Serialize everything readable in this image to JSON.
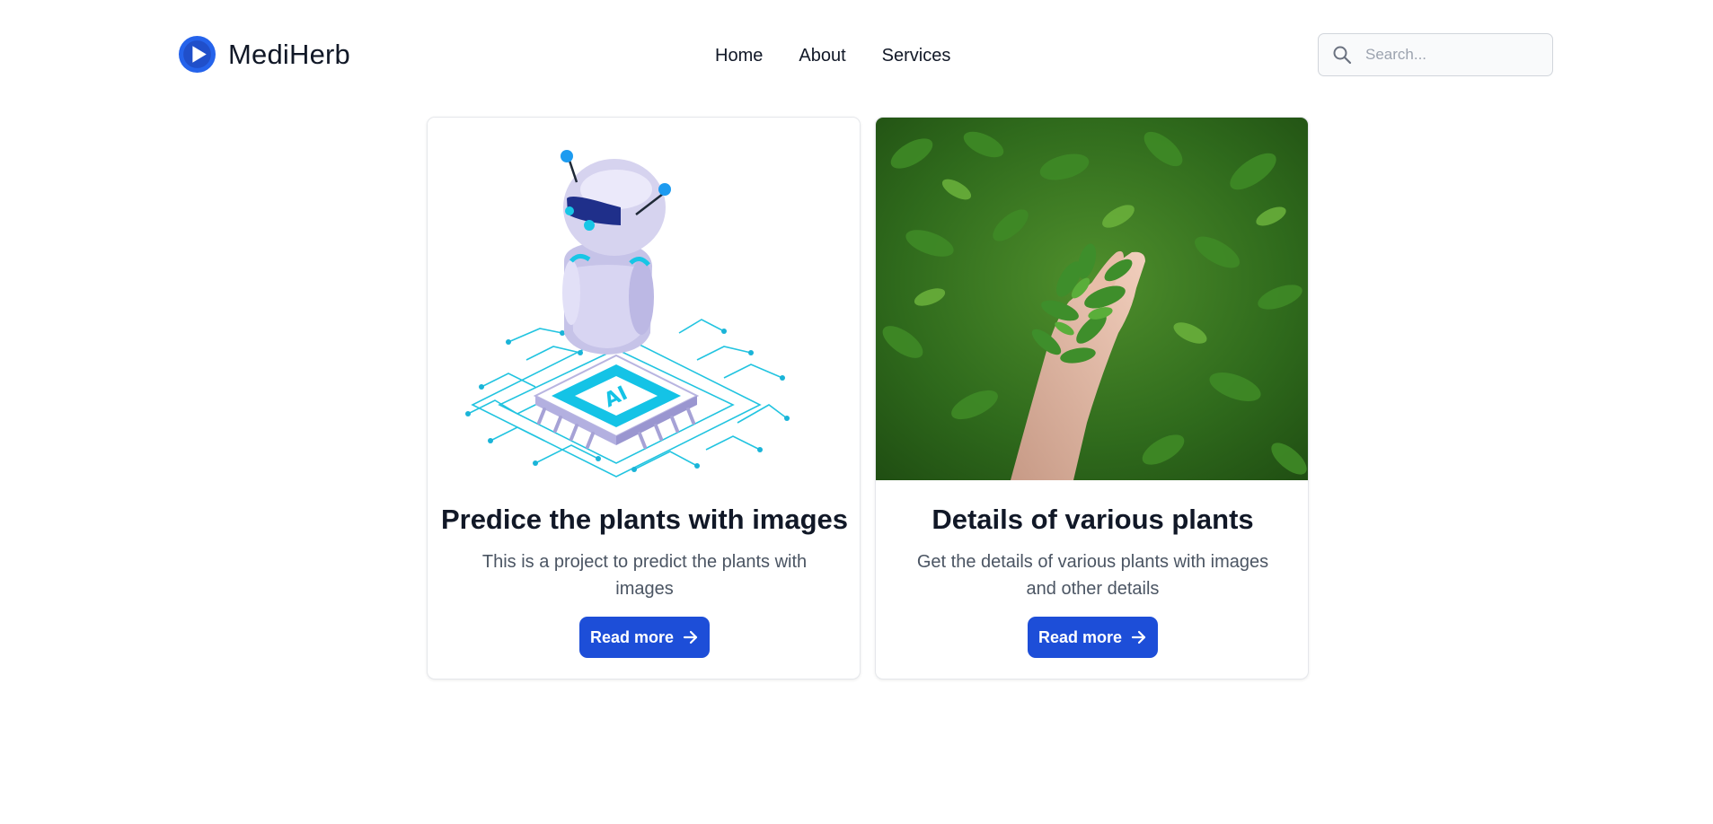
{
  "brand": {
    "name": "MediHerb",
    "logo_icon": "play-circle-icon",
    "logo_color": "#2563eb"
  },
  "nav": {
    "items": [
      {
        "label": "Home"
      },
      {
        "label": "About"
      },
      {
        "label": "Services"
      }
    ]
  },
  "search": {
    "placeholder": "Search...",
    "value": "",
    "icon": "search-icon"
  },
  "cards": [
    {
      "title": "Predice the plants with images",
      "text": "This is a project to predict the plants with images",
      "button_label": "Read more",
      "image": "ai-robot-chip-illustration",
      "button_icon": "arrow-right-icon"
    },
    {
      "title": "Details of various plants",
      "text": "Get the details of various plants with images and other details",
      "button_label": "Read more",
      "image": "hand-holding-mint-leaves-photo",
      "button_icon": "arrow-right-icon"
    }
  ],
  "colors": {
    "primary_button": "#1d4ed8",
    "text_dark": "#111827",
    "text_muted": "#4b5563",
    "border": "#e5e7eb"
  }
}
